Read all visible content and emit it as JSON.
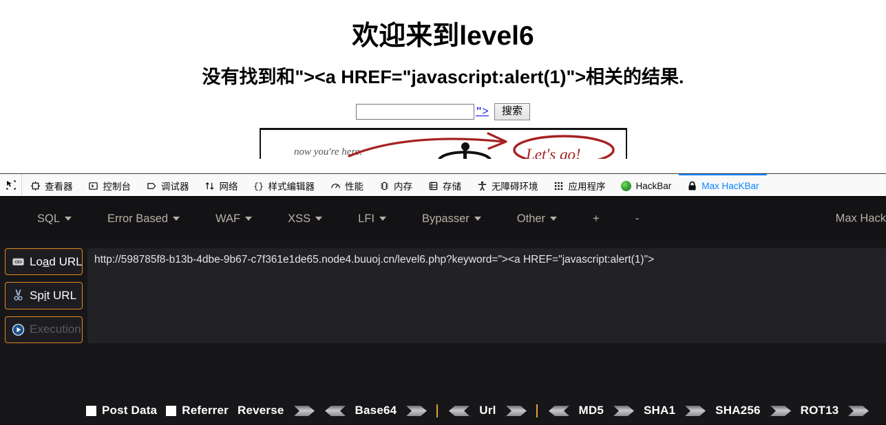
{
  "page": {
    "title": "欢迎来到level6",
    "subtitle": "没有找到和\"><a HREF=\"javascript:alert(1)\">相关的结果.",
    "search": {
      "value": "",
      "placeholder": "",
      "injected_link_text": "\">",
      "button_label": "搜索"
    },
    "hero": {
      "caption": "now you're here.",
      "annotation": "Let's go!",
      "arrow_color": "#a52222"
    }
  },
  "devtools": {
    "picker_icon": "element-picker-icon",
    "tabs": [
      {
        "label": "查看器",
        "icon": "inspector-icon",
        "active": false
      },
      {
        "label": "控制台",
        "icon": "console-icon",
        "active": false
      },
      {
        "label": "调试器",
        "icon": "debugger-icon",
        "active": false
      },
      {
        "label": "网络",
        "icon": "network-icon",
        "active": false
      },
      {
        "label": "样式编辑器",
        "icon": "style-editor-icon",
        "active": false
      },
      {
        "label": "性能",
        "icon": "performance-icon",
        "active": false
      },
      {
        "label": "内存",
        "icon": "memory-icon",
        "active": false
      },
      {
        "label": "存储",
        "icon": "storage-icon",
        "active": false
      },
      {
        "label": "无障碍环境",
        "icon": "accessibility-icon",
        "active": false
      },
      {
        "label": "应用程序",
        "icon": "application-icon",
        "active": false
      },
      {
        "label": "HackBar",
        "icon": "hackbar-firefox-icon",
        "active": false
      },
      {
        "label": "Max HacKBar",
        "icon": "lock-icon",
        "active": true
      }
    ],
    "active_tab_color": "#0a84ff"
  },
  "hackbar": {
    "menus": [
      {
        "label": "SQL",
        "has_caret": true
      },
      {
        "label": "Error Based",
        "has_caret": true
      },
      {
        "label": "WAF",
        "has_caret": true
      },
      {
        "label": "XSS",
        "has_caret": true
      },
      {
        "label": "LFI",
        "has_caret": true
      },
      {
        "label": "Bypasser",
        "has_caret": true
      },
      {
        "label": "Other",
        "has_caret": true
      },
      {
        "label": "+",
        "has_caret": false
      },
      {
        "label": "-",
        "has_caret": false
      }
    ],
    "brand": "Max Hack",
    "buttons": [
      {
        "label_pre": "Lo",
        "accesskey": "a",
        "label_post": "d URL",
        "icon": "load-url-icon",
        "disabled": false
      },
      {
        "label_pre": "Sp",
        "accesskey": "i",
        "label_post": "t URL",
        "icon": "split-url-icon",
        "disabled": false
      },
      {
        "label_pre": "Execution",
        "accesskey": "",
        "label_post": "",
        "icon": "execute-icon",
        "disabled": true
      }
    ],
    "url_value": "http://598785f8-b13b-4dbe-9b67-c7f361e1de65.node4.buuoj.cn/level6.php?keyword=\"><a HREF=\"javascript:alert(1)\">",
    "footer": {
      "post_data_label": "Post Data",
      "post_data_checked": false,
      "referrer_label": "Referrer",
      "referrer_checked": false,
      "tools": [
        {
          "label": "Reverse",
          "encode": true,
          "decode": true,
          "separator_after": false
        },
        {
          "label": "Base64",
          "encode": true,
          "decode": true,
          "separator_after": true
        },
        {
          "label": "Url",
          "encode": true,
          "decode": false,
          "separator_after": true
        },
        {
          "label": "MD5",
          "encode": true,
          "decode": false,
          "separator_after": false
        },
        {
          "label": "SHA1",
          "encode": true,
          "decode": false,
          "separator_after": false
        },
        {
          "label": "SHA256",
          "encode": true,
          "decode": false,
          "separator_after": false
        },
        {
          "label": "ROT13",
          "encode": true,
          "decode": false,
          "separator_after": false
        }
      ]
    },
    "accent_color": "#e08a1e"
  }
}
